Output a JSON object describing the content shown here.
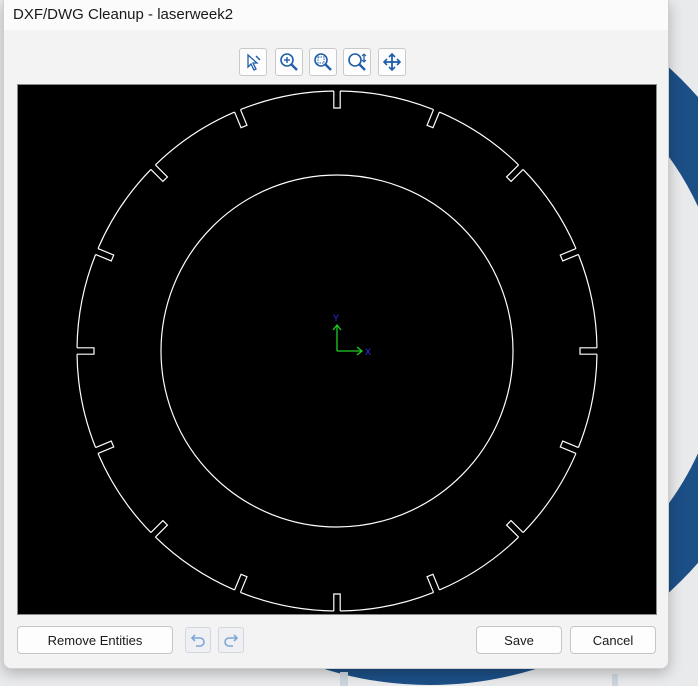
{
  "window": {
    "title": "DXF/DWG Cleanup - laserweek2"
  },
  "toolbar": {
    "icons": [
      "select-pointer-icon",
      "zoom-in-icon",
      "zoom-window-icon",
      "zoom-extents-icon",
      "pan-icon"
    ]
  },
  "canvas": {
    "background_color": "#000000",
    "stroke_color": "#ffffff",
    "axis": {
      "x_label": "X",
      "y_label": "Y",
      "x_color": "#2222ff",
      "y_color": "#22cc22"
    }
  },
  "footer": {
    "remove_entities_label": "Remove Entities",
    "save_label": "Save",
    "cancel_label": "Cancel",
    "undo_icon": "undo-icon",
    "redo_icon": "redo-icon"
  },
  "colors": {
    "accent": "#1f5fa8",
    "background_shape": "#1c4f86"
  }
}
